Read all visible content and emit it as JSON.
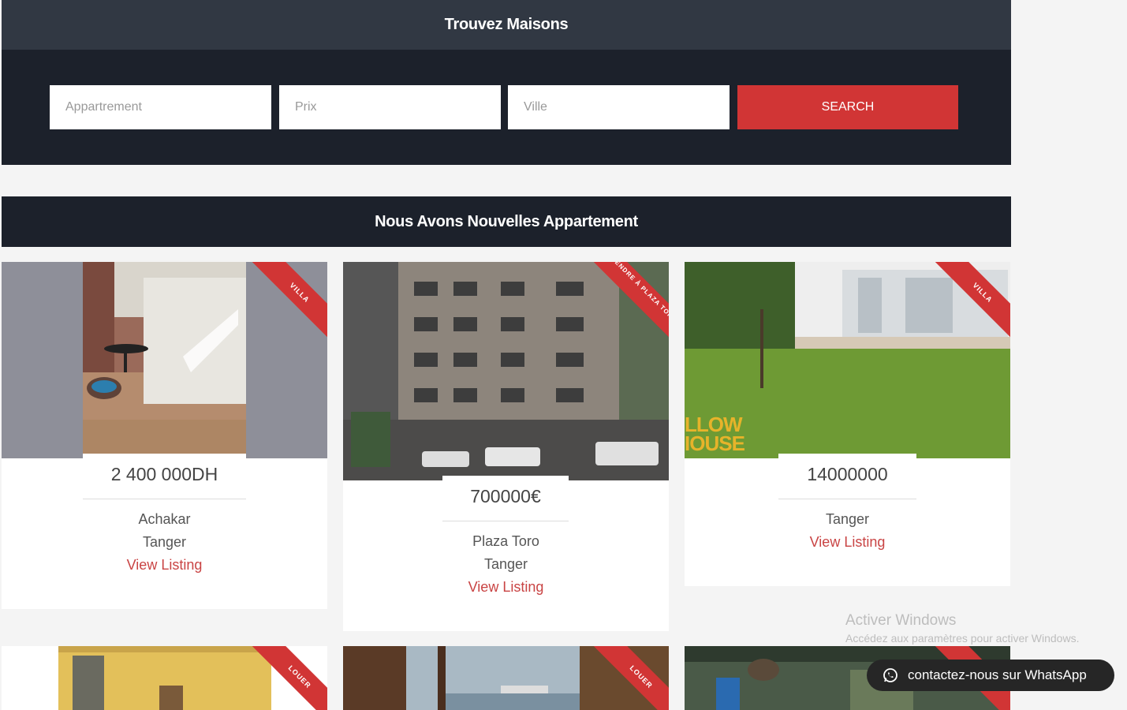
{
  "search": {
    "header": "Trouvez Maisons",
    "type_placeholder": "Appartrement",
    "price_placeholder": "Prix",
    "city_placeholder": "Ville",
    "button_label": "SEARCH"
  },
  "section_title": "Nous Avons Nouvelles Appartement",
  "listings": [
    {
      "ribbon": "VILLA",
      "price": "2 400 000DH",
      "line1": "Achakar",
      "line2": "Tanger",
      "link": "View Listing"
    },
    {
      "ribbon": "VENDRE À PLAZA TORO",
      "price": "700000€",
      "line1": "Plaza Toro",
      "line2": "Tanger",
      "link": "View Listing"
    },
    {
      "ribbon": "VILLA",
      "price": "14000000",
      "line1": "Tanger",
      "link": "View Listing"
    },
    {
      "ribbon": "LOUER"
    },
    {
      "ribbon": "LOUER"
    },
    {
      "ribbon": ""
    }
  ],
  "image_texts": {
    "watermark_line1": "LLOW",
    "watermark_line2": "IOUSE"
  },
  "windows_activation": {
    "title": "Activer Windows",
    "subtitle": "Accédez aux paramètres pour activer Windows."
  },
  "whatsapp": {
    "label": "contactez-nous sur WhatsApp"
  },
  "colors": {
    "accent": "#d13535",
    "header_dark": "#1c212b",
    "header_light": "#313843",
    "link": "#c94444"
  }
}
